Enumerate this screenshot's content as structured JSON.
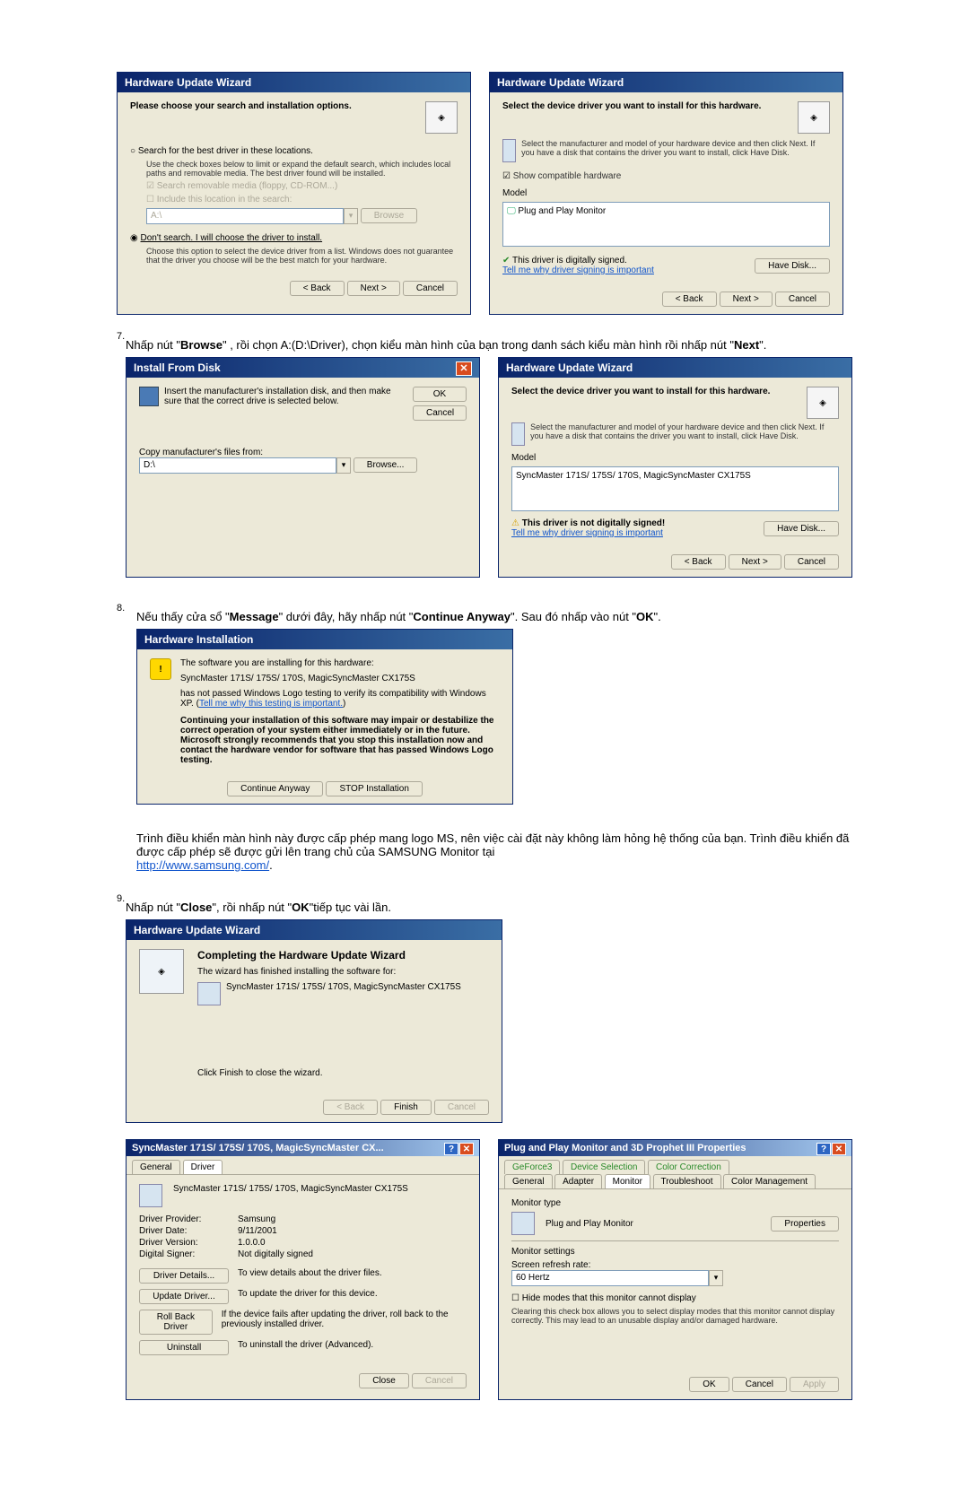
{
  "step7": {
    "number": "7.",
    "text_prefix": "Nhấp nút \"",
    "browse": "Browse",
    "text_mid": "\" , rồi chọn A:(D:\\Driver), chọn kiểu màn hình của bạn trong danh sách kiểu màn hình rồi nhấp nút \"",
    "next": "Next",
    "text_suffix": "\"."
  },
  "step8": {
    "number": "8.",
    "text_prefix": "Nếu thấy cửa sổ \"",
    "message": "Message",
    "text_mid1": "\" dưới đây, hãy nhấp nút \"",
    "continue": "Continue Anyway",
    "text_mid2": "\". Sau đó nhấp vào nút \"",
    "ok": "OK",
    "text_suffix": "\"."
  },
  "step8_paragraph": "Trình điều khiển màn hình này được cấp phép mang logo MS, nên việc cài đặt này không làm hỏng hệ thống của bạn. Trình điều khiển đã được cấp phép sẽ được gửi lên trang chủ của SAMSUNG Monitor tại",
  "samsung_url": "http://www.samsung.com/",
  "step9": {
    "number": "9.",
    "text_prefix": "Nhấp nút \"",
    "close": "Close",
    "text_mid": "\", rồi nhấp nút \"",
    "ok": "OK",
    "text_suffix": "\"tiếp tục vài lần."
  },
  "hw_wizard1": {
    "title": "Hardware Update Wizard",
    "heading": "Please choose your search and installation options.",
    "opt1": "Search for the best driver in these locations.",
    "opt1_desc": "Use the check boxes below to limit or expand the default search, which includes local paths and removable media. The best driver found will be installed.",
    "chk1": "Search removable media (floppy, CD-ROM...)",
    "chk2": "Include this location in the search:",
    "path": "A:\\",
    "browse_btn": "Browse",
    "opt2": "Don't search. I will choose the driver to install.",
    "opt2_desc": "Choose this option to select the device driver from a list. Windows does not guarantee that the driver you choose will be the best match for your hardware.",
    "back": "< Back",
    "next": "Next >",
    "cancel": "Cancel"
  },
  "hw_wizard2": {
    "title": "Hardware Update Wizard",
    "heading": "Select the device driver you want to install for this hardware.",
    "desc": "Select the manufacturer and model of your hardware device and then click Next. If you have a disk that contains the driver you want to install, click Have Disk.",
    "show_compat": "Show compatible hardware",
    "model_label": "Model",
    "model": "Plug and Play Monitor",
    "signed": "This driver is digitally signed.",
    "tell_me": "Tell me why driver signing is important",
    "have_disk": "Have Disk...",
    "back": "< Back",
    "next": "Next >",
    "cancel": "Cancel"
  },
  "install_disk": {
    "title": "Install From Disk",
    "instruction": "Insert the manufacturer's installation disk, and then make sure that the correct drive is selected below.",
    "ok": "OK",
    "cancel": "Cancel",
    "copy_label": "Copy manufacturer's files from:",
    "path": "D:\\",
    "browse": "Browse..."
  },
  "hw_wizard3": {
    "title": "Hardware Update Wizard",
    "heading": "Select the device driver you want to install for this hardware.",
    "desc": "Select the manufacturer and model of your hardware device and then click Next. If you have a disk that contains the driver you want to install, click Have Disk.",
    "model_label": "Model",
    "model": "SyncMaster 171S/ 175S/ 170S, MagicSyncMaster CX175S",
    "not_signed": "This driver is not digitally signed!",
    "tell_me": "Tell me why driver signing is important",
    "have_disk": "Have Disk...",
    "back": "< Back",
    "next": "Next >",
    "cancel": "Cancel"
  },
  "hw_install": {
    "title": "Hardware Installation",
    "line1": "The software you are installing for this hardware:",
    "line2": "SyncMaster 171S/ 175S/ 170S, MagicSyncMaster CX175S",
    "line3a": "has not passed Windows Logo testing to verify its compatibility with Windows XP. (",
    "line3_link": "Tell me why this testing is important.",
    "line3b": ")",
    "warn": "Continuing your installation of this software may impair or destabilize the correct operation of your system either immediately or in the future. Microsoft strongly recommends that you stop this installation now and contact the hardware vendor for software that has passed Windows Logo testing.",
    "continue": "Continue Anyway",
    "stop": "STOP Installation"
  },
  "hw_complete": {
    "title": "Hardware Update Wizard",
    "heading": "Completing the Hardware Update Wizard",
    "line1": "The wizard has finished installing the software for:",
    "device": "SyncMaster 171S/ 175S/ 170S, MagicSyncMaster CX175S",
    "finish_note": "Click Finish to close the wizard.",
    "back": "< Back",
    "finish": "Finish",
    "cancel": "Cancel"
  },
  "driver_props": {
    "title": "SyncMaster 171S/ 175S/ 170S, MagicSyncMaster CX...",
    "tab_general": "General",
    "tab_driver": "Driver",
    "device": "SyncMaster 171S/ 175S/ 170S, MagicSyncMaster CX175S",
    "provider_label": "Driver Provider:",
    "provider": "Samsung",
    "date_label": "Driver Date:",
    "date": "9/11/2001",
    "version_label": "Driver Version:",
    "version": "1.0.0.0",
    "signer_label": "Digital Signer:",
    "signer": "Not digitally signed",
    "details_btn": "Driver Details...",
    "details_desc": "To view details about the driver files.",
    "update_btn": "Update Driver...",
    "update_desc": "To update the driver for this device.",
    "rollback_btn": "Roll Back Driver",
    "rollback_desc": "If the device fails after updating the driver, roll back to the previously installed driver.",
    "uninstall_btn": "Uninstall",
    "uninstall_desc": "To uninstall the driver (Advanced).",
    "close": "Close",
    "cancel": "Cancel"
  },
  "display_props": {
    "title": "Plug and Play Monitor and 3D Prophet III Properties",
    "tabs": {
      "geforce": "GeForce3",
      "device_sel": "Device Selection",
      "color_corr": "Color Correction",
      "general": "General",
      "adapter": "Adapter",
      "monitor": "Monitor",
      "troubleshoot": "Troubleshoot",
      "color_mgmt": "Color Management"
    },
    "monitor_type_label": "Monitor type",
    "monitor_name": "Plug and Play Monitor",
    "properties_btn": "Properties",
    "settings_label": "Monitor settings",
    "refresh_label": "Screen refresh rate:",
    "refresh_value": "60 Hertz",
    "hide_modes": "Hide modes that this monitor cannot display",
    "hide_desc": "Clearing this check box allows you to select display modes that this monitor cannot display correctly. This may lead to an unusable display and/or damaged hardware.",
    "ok": "OK",
    "cancel": "Cancel",
    "apply": "Apply"
  }
}
